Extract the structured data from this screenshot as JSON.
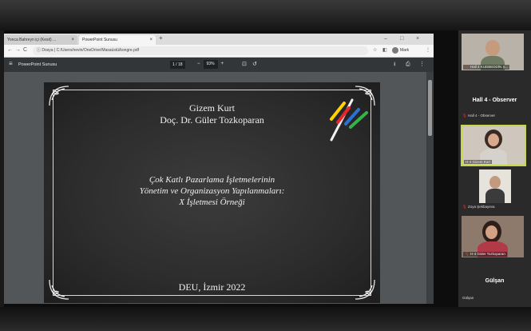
{
  "browser": {
    "tabs": [
      {
        "label": "Yonca Bahreyn içi (Kesit) ..."
      },
      {
        "label": "PowerPoint Sunusu"
      }
    ],
    "address": "Dosya | C:/Users/nevin/OneDrive/Masaüstü/kongre.pdf",
    "profile_label": "Mark"
  },
  "pdf": {
    "title": "PowerPoint Sunusu",
    "page": "1 / 18",
    "zoom": "93%"
  },
  "slide": {
    "name": "Gizem Kurt",
    "advisor": "Doç. Dr. Güler Tozkoparan",
    "title_line1": "Çok Katlı Pazarlama İşletmelerinin",
    "title_line2": "Yönetim ve Organizasyon Yapılanmaları:",
    "title_line3": "X İşletmesi Örneği",
    "footer": "DEU, İzmir 2022"
  },
  "participants": {
    "tile1_label": "Hall 4 KUDBEDDİN Ş...",
    "observer_heading": "Hall 4 - Observer",
    "observer_small": "Hall 4 - Observer",
    "tile2_label": "H-4 Gizem Kurt",
    "tile3_label": "Zoya Şekbayeva",
    "tile4_label": "H-4 Güler Tozkoparan",
    "gulsan_heading": "Gülşan",
    "gulsan_small": "Gülşan"
  },
  "colors": {
    "slide_bg": "#2c2c2c",
    "active_speaker_border": "#c6d84a",
    "muted_mic": "#e53935"
  },
  "icons": [
    "menu-icon",
    "back-icon",
    "forward-icon",
    "reload-icon",
    "info-icon",
    "star-icon",
    "extension-icon",
    "download-icon",
    "print-icon",
    "more-icon",
    "fit-page-icon",
    "rotate-icon",
    "muted-mic-icon",
    "new-tab-icon",
    "close-tab-icon"
  ]
}
